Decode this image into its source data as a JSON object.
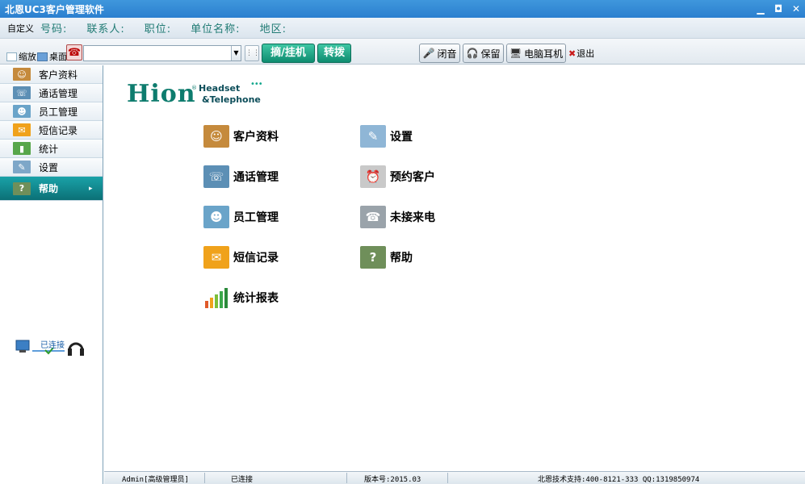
{
  "window": {
    "title": "北恩UC3客户管理软件",
    "minimize": "▁",
    "maximize": "◘",
    "close": "✕"
  },
  "infobar": {
    "custom": "自定义",
    "fields": [
      "号码:",
      "联系人:",
      "职位:",
      "单位名称:",
      "地区:"
    ]
  },
  "toolbar": {
    "zoom_label": "缩放",
    "desktop_label": "桌面",
    "number_input_value": "",
    "pickup_label": "摘/挂机",
    "transfer_label": "转拨",
    "mute_label": "闭音",
    "hold_label": "保留",
    "pc_headset_label": "电脑耳机",
    "exit_label": "退出"
  },
  "sidebar": {
    "items": [
      {
        "label": "客户资料",
        "icon": "customer-icon"
      },
      {
        "label": "通话管理",
        "icon": "call-icon"
      },
      {
        "label": "员工管理",
        "icon": "staff-icon"
      },
      {
        "label": "短信记录",
        "icon": "sms-icon"
      },
      {
        "label": "统计",
        "icon": "stats-icon"
      },
      {
        "label": "设置",
        "icon": "settings-icon"
      },
      {
        "label": "帮助",
        "icon": "help-icon",
        "active": true
      }
    ],
    "connection_status": "已连接"
  },
  "main": {
    "logo": {
      "brand": "Hion",
      "line1": "Headset",
      "line2": "&Telephone"
    },
    "features": [
      {
        "label": "客户资料",
        "icon": "customer-icon"
      },
      {
        "label": "设置",
        "icon": "settings-icon"
      },
      {
        "label": "通话管理",
        "icon": "call-icon"
      },
      {
        "label": "预约客户",
        "icon": "alarm-clock-icon"
      },
      {
        "label": "员工管理",
        "icon": "staff-icon"
      },
      {
        "label": "未接来电",
        "icon": "missed-call-icon"
      },
      {
        "label": "短信记录",
        "icon": "sms-icon"
      },
      {
        "label": "帮助",
        "icon": "help-icon"
      },
      {
        "label": "统计报表",
        "icon": "stats-icon"
      }
    ]
  },
  "statusbar": {
    "user": "Admin[高级管理员]",
    "connection": "已连接",
    "version": "版本号:2015.03",
    "support": "北恩技术支持:400-8121-333 QQ:1319850974"
  },
  "colors": {
    "accent": "#0e7c6e",
    "titlebar": "#2b7fcf",
    "active_menu": "#0b7076"
  }
}
